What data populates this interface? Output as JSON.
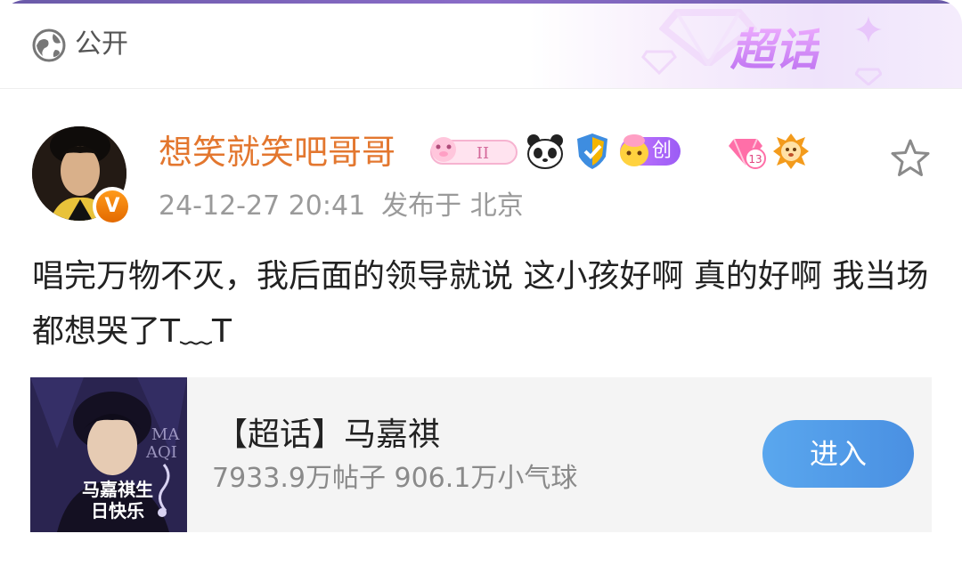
{
  "header": {
    "visibility": "公开",
    "super_topic_logo": "超话"
  },
  "post": {
    "author": "想笑就笑吧哥哥",
    "creator_badge": "创作官",
    "level_badge": "13",
    "timestamp": "24-12-27 20:41",
    "posted_from": "发布于 北京",
    "content": "唱完万物不灭，我后面的领导就说 这小孩好啊 真的好啊 我当场都想哭了T﹏T"
  },
  "topic_card": {
    "title": "【超话】马嘉祺",
    "stats": "7933.9万帖子 906.1万小气球",
    "enter_label": "进入",
    "thumb_caption": "马嘉祺生日快乐"
  },
  "colors": {
    "username": "#e3772f",
    "accent_button": "#4a90e2",
    "badge_purple": "#9b5cf5"
  },
  "icons": [
    "globe-icon",
    "verified-v-icon",
    "level-ii-badge-icon",
    "panda-icon",
    "shield-icon",
    "creator-badge-icon",
    "level-13-badge-icon",
    "lion-icon",
    "star-icon"
  ]
}
